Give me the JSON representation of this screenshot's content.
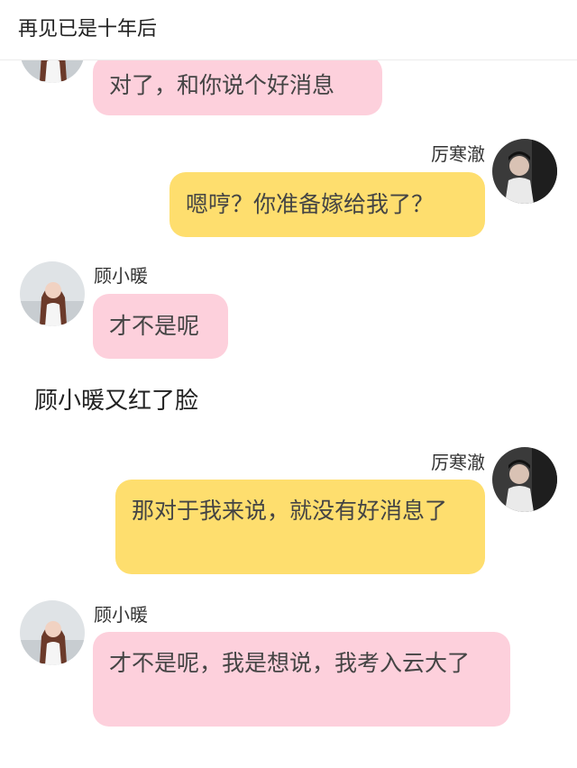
{
  "header": {
    "title": "再见已是十年后"
  },
  "characters": {
    "female": {
      "name": "顾小暖"
    },
    "male": {
      "name": "厉寒澈"
    }
  },
  "messages": [
    {
      "speaker": "顾小暖",
      "text": "对了，和你说个好消息"
    },
    {
      "speaker": "厉寒澈",
      "text": "嗯哼？你准备嫁给我了？"
    },
    {
      "speaker": "顾小暖",
      "text": "才不是呢"
    },
    {
      "speaker": "厉寒澈",
      "text": "那对于我来说，就没有好消息了"
    },
    {
      "speaker": "顾小暖",
      "text": "才不是呢，我是想说，我考入云大了"
    }
  ],
  "narration": "顾小暖又红了脸",
  "colors": {
    "female_bubble": "#fdd0dc",
    "male_bubble": "#fede6e"
  }
}
